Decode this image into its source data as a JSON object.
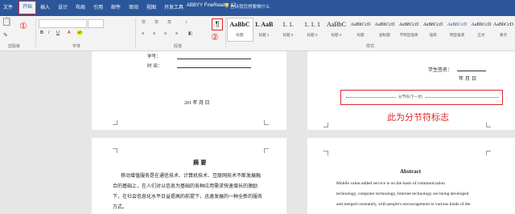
{
  "tabs": {
    "file": "文件",
    "home": "开始",
    "insert": "插入",
    "design": "设计",
    "layout": "布局",
    "references": "引用",
    "mailings": "邮件",
    "review": "审阅",
    "view": "视图",
    "developer": "开发工具",
    "abbyy": "ABBYY FineReader 12",
    "tell_me": "告诉我您想要做什么"
  },
  "ribbon": {
    "clipboard_label": "剪贴板",
    "font_label": "字体",
    "paragraph_label": "段落",
    "styles_label": "样式",
    "step1": "①",
    "step2": "②",
    "pilcrow": "¶",
    "styles": [
      {
        "sample": "AaBbC",
        "label": "标题"
      },
      {
        "sample": "1. AaB",
        "label": "标题 1"
      },
      {
        "sample": "1. 1.",
        "label": "标题 2"
      },
      {
        "sample": "1. 1. 1",
        "label": "标题 3"
      },
      {
        "sample": "AaBbC",
        "label": "标题 4"
      },
      {
        "sample": "AaBbCcD",
        "label": "标题"
      },
      {
        "sample": "AaBbCcD",
        "label": "副标题"
      },
      {
        "sample": "AaBbCcD",
        "label": "不明显强调"
      },
      {
        "sample": "AaBbCcD",
        "label": "强调"
      },
      {
        "sample": "AaBbCcD",
        "label": "明显强调"
      },
      {
        "sample": "AaBbCcD",
        "label": "正文"
      },
      {
        "sample": "AaBbCcD",
        "label": "要点"
      }
    ]
  },
  "page1": {
    "line_a": "学号：",
    "line_b": "时  间：",
    "date": "201  年  月  日"
  },
  "page2": {
    "signature": "学生签名：",
    "date": "年   月   日",
    "section_break": "分节符(下一页)",
    "annotation": "此为分节符标志"
  },
  "page3": {
    "title": "摘  要",
    "lines": [
      "移动增值服务是在通信技术、计算机技术、互联网技术不断发展融",
      "合的基础上，在人们对以信息为基础的各种应用需求快速增长的激励",
      "下，在社会信息化水平日益提高的前提下，迅速发展的一种全新的服务",
      "方式。"
    ]
  },
  "page4": {
    "title": "Abstract",
    "lines": [
      "Mobile  value-added  service  is  on  the  basis  of  communication",
      "technology, computer technology, Internet technology are being developed",
      "and merged constantly, with people's encouragement to various kinds of the"
    ]
  },
  "colors": {
    "ribbon_blue": "#2b579a",
    "annotation_red": "#e0262a"
  }
}
